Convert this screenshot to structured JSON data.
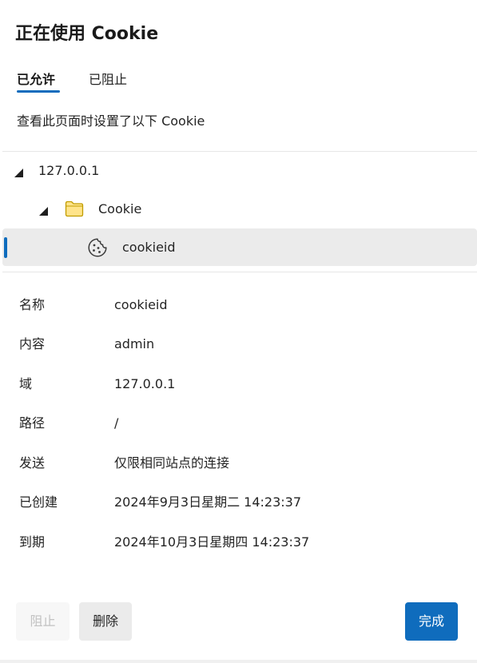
{
  "dialog": {
    "title": "正在使用 Cookie",
    "tabs": [
      {
        "label": "已允许",
        "selected": true
      },
      {
        "label": "已阻止",
        "selected": false
      }
    ],
    "subtitle": "查看此页面时设置了以下 Cookie"
  },
  "tree": {
    "site": {
      "label": "127.0.0.1",
      "expanded": true
    },
    "folder": {
      "label": "Cookie",
      "expanded": true,
      "icon": "folder-icon"
    },
    "cookie": {
      "label": "cookieid",
      "selected": true,
      "icon": "cookie-icon"
    }
  },
  "details": [
    {
      "label": "名称",
      "value": "cookieid"
    },
    {
      "label": "内容",
      "value": "admin"
    },
    {
      "label": "域",
      "value": "127.0.0.1"
    },
    {
      "label": "路径",
      "value": "/"
    },
    {
      "label": "发送",
      "value": "仅限相同站点的连接"
    },
    {
      "label": "已创建",
      "value": "2024年9月3日星期二 14:23:37"
    },
    {
      "label": "到期",
      "value": "2024年10月3日星期四 14:23:37"
    }
  ],
  "buttons": {
    "block": {
      "label": "阻止",
      "enabled": false
    },
    "delete": {
      "label": "删除",
      "enabled": true
    },
    "done": {
      "label": "完成",
      "enabled": true
    }
  },
  "colors": {
    "accent": "#0f6cbd",
    "selected_row": "#ebebeb",
    "folder_fill": "#ffe48a",
    "folder_stroke": "#c19c00"
  }
}
